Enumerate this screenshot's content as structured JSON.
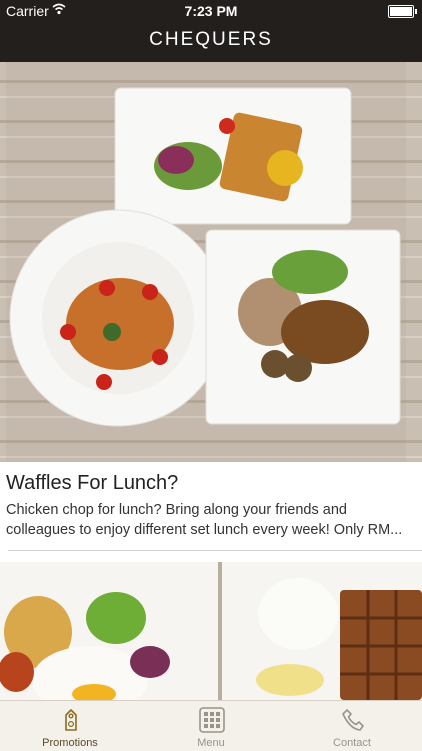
{
  "status_bar": {
    "carrier": "Carrier",
    "time": "7:23 PM"
  },
  "header": {
    "logo": "CHEQUERS"
  },
  "promotion": {
    "title": "Waffles For Lunch?",
    "description": "Chicken chop for lunch? Bring along your friends and colleagues to enjoy different set lunch every week! Only RM..."
  },
  "tabs": [
    {
      "label": "Promotions",
      "icon": "tag-icon",
      "active": true
    },
    {
      "label": "Menu",
      "icon": "grid-icon",
      "active": false
    },
    {
      "label": "Contact",
      "icon": "phone-icon",
      "active": false
    }
  ],
  "colors": {
    "header_bg": "#231f1d",
    "active_tab": "#5a4a2a",
    "inactive_tab": "#9a938a"
  }
}
